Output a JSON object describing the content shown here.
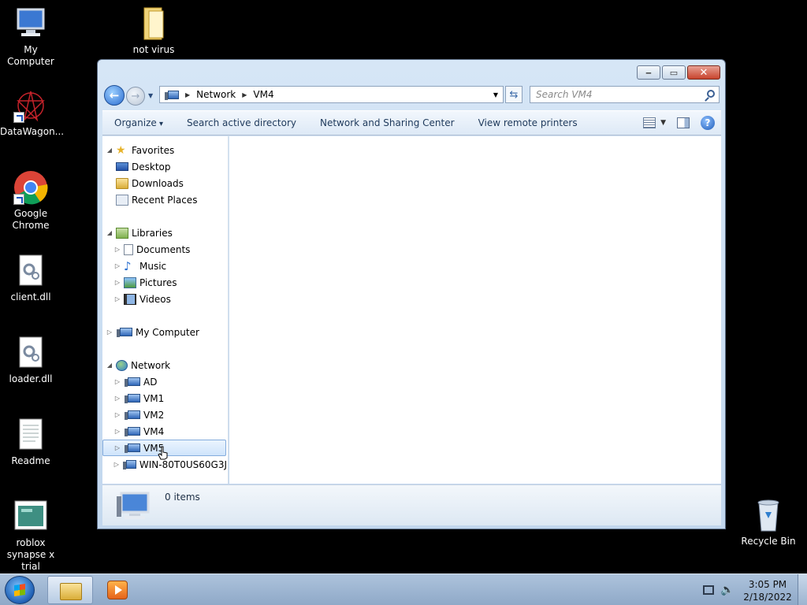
{
  "desktop": {
    "icons": [
      {
        "label": "My Computer",
        "icon": "computer-icon"
      },
      {
        "label": "not virus",
        "icon": "folder-icon"
      },
      {
        "label": "DataWagon...",
        "icon": "datawagon-shortcut-icon"
      },
      {
        "label": "Google Chrome",
        "icon": "chrome-shortcut-icon"
      },
      {
        "label": "client.dll",
        "icon": "dll-file-icon"
      },
      {
        "label": "loader.dll",
        "icon": "dll-file-icon"
      },
      {
        "label": "Readme",
        "icon": "text-file-icon"
      },
      {
        "label": "roblox synapse x trial",
        "icon": "app-icon"
      },
      {
        "label": "Recycle Bin",
        "icon": "recycle-bin-icon"
      }
    ]
  },
  "window": {
    "caption": {
      "minimize": "‒",
      "maximize": "▭",
      "close": "✕"
    },
    "address": {
      "crumbs": [
        "Network",
        "VM4"
      ]
    },
    "search": {
      "placeholder": "Search VM4"
    },
    "commands": [
      "Organize",
      "Search active directory",
      "Network and Sharing Center",
      "View remote printers"
    ],
    "nav": {
      "favorites": {
        "label": "Favorites",
        "items": [
          "Desktop",
          "Downloads",
          "Recent Places"
        ]
      },
      "libraries": {
        "label": "Libraries",
        "items": [
          "Documents",
          "Music",
          "Pictures",
          "Videos"
        ]
      },
      "computer": {
        "label": "My Computer"
      },
      "network": {
        "label": "Network",
        "items": [
          "AD",
          "VM1",
          "VM2",
          "VM4",
          "VM5",
          "WIN-80T0US60G3J"
        ],
        "selected": "VM5"
      }
    },
    "status": {
      "items_text": "0 items"
    }
  },
  "taskbar": {
    "time": "3:05 PM",
    "date": "2/18/2022"
  },
  "colors": {
    "accent": "#2a6bd0",
    "window_frame": "#c2d7ee",
    "selection": "#cfe4fb"
  }
}
